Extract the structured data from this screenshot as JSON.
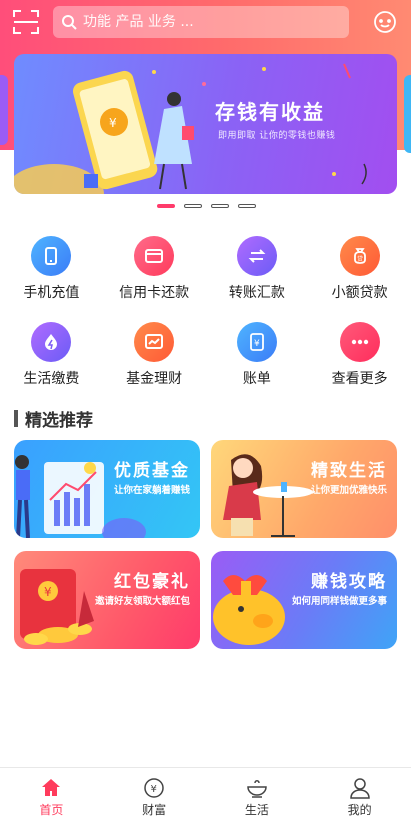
{
  "header": {
    "search_placeholder": "功能 产品 业务 ...",
    "bg_colors": [
      "#ff4e7a",
      "#ff8a72"
    ]
  },
  "banner": {
    "title": "存钱有收益",
    "subtitle": "即用即取  让你的零钱也赚钱",
    "slide_count": 4,
    "active_slide": 1
  },
  "grid": [
    {
      "label": "手机充值",
      "icon": "phone-icon",
      "color": "#3b9cf7"
    },
    {
      "label": "信用卡还款",
      "icon": "credit-card-icon",
      "color": "#ff4b6e"
    },
    {
      "label": "转账汇款",
      "icon": "transfer-icon",
      "color": "#8b5cf6"
    },
    {
      "label": "小额贷款",
      "icon": "money-bag-icon",
      "color": "#ff6b3d"
    },
    {
      "label": "生活缴费",
      "icon": "water-drop-icon",
      "color": "#8b5cf6"
    },
    {
      "label": "基金理财",
      "icon": "chart-icon",
      "color": "#ff6b3d"
    },
    {
      "label": "账单",
      "icon": "bill-icon",
      "color": "#3b9cf7"
    },
    {
      "label": "查看更多",
      "icon": "more-icon",
      "color": "#ff3b6b"
    }
  ],
  "section": {
    "title": "精选推荐"
  },
  "cards": [
    {
      "title": "优质基金",
      "subtitle": "让你在家躺着赚钱"
    },
    {
      "title": "精致生活",
      "subtitle": "让你更加优雅快乐"
    },
    {
      "title": "红包豪礼",
      "subtitle": "邀请好友领取大额红包"
    },
    {
      "title": "赚钱攻略",
      "subtitle": "如何用同样钱做更多事"
    }
  ],
  "tabs": [
    {
      "label": "首页",
      "icon": "home-icon",
      "active": true
    },
    {
      "label": "财富",
      "icon": "wealth-icon",
      "active": false
    },
    {
      "label": "生活",
      "icon": "life-icon",
      "active": false
    },
    {
      "label": "我的",
      "icon": "user-icon",
      "active": false
    }
  ],
  "accent": "#ff3b5c"
}
